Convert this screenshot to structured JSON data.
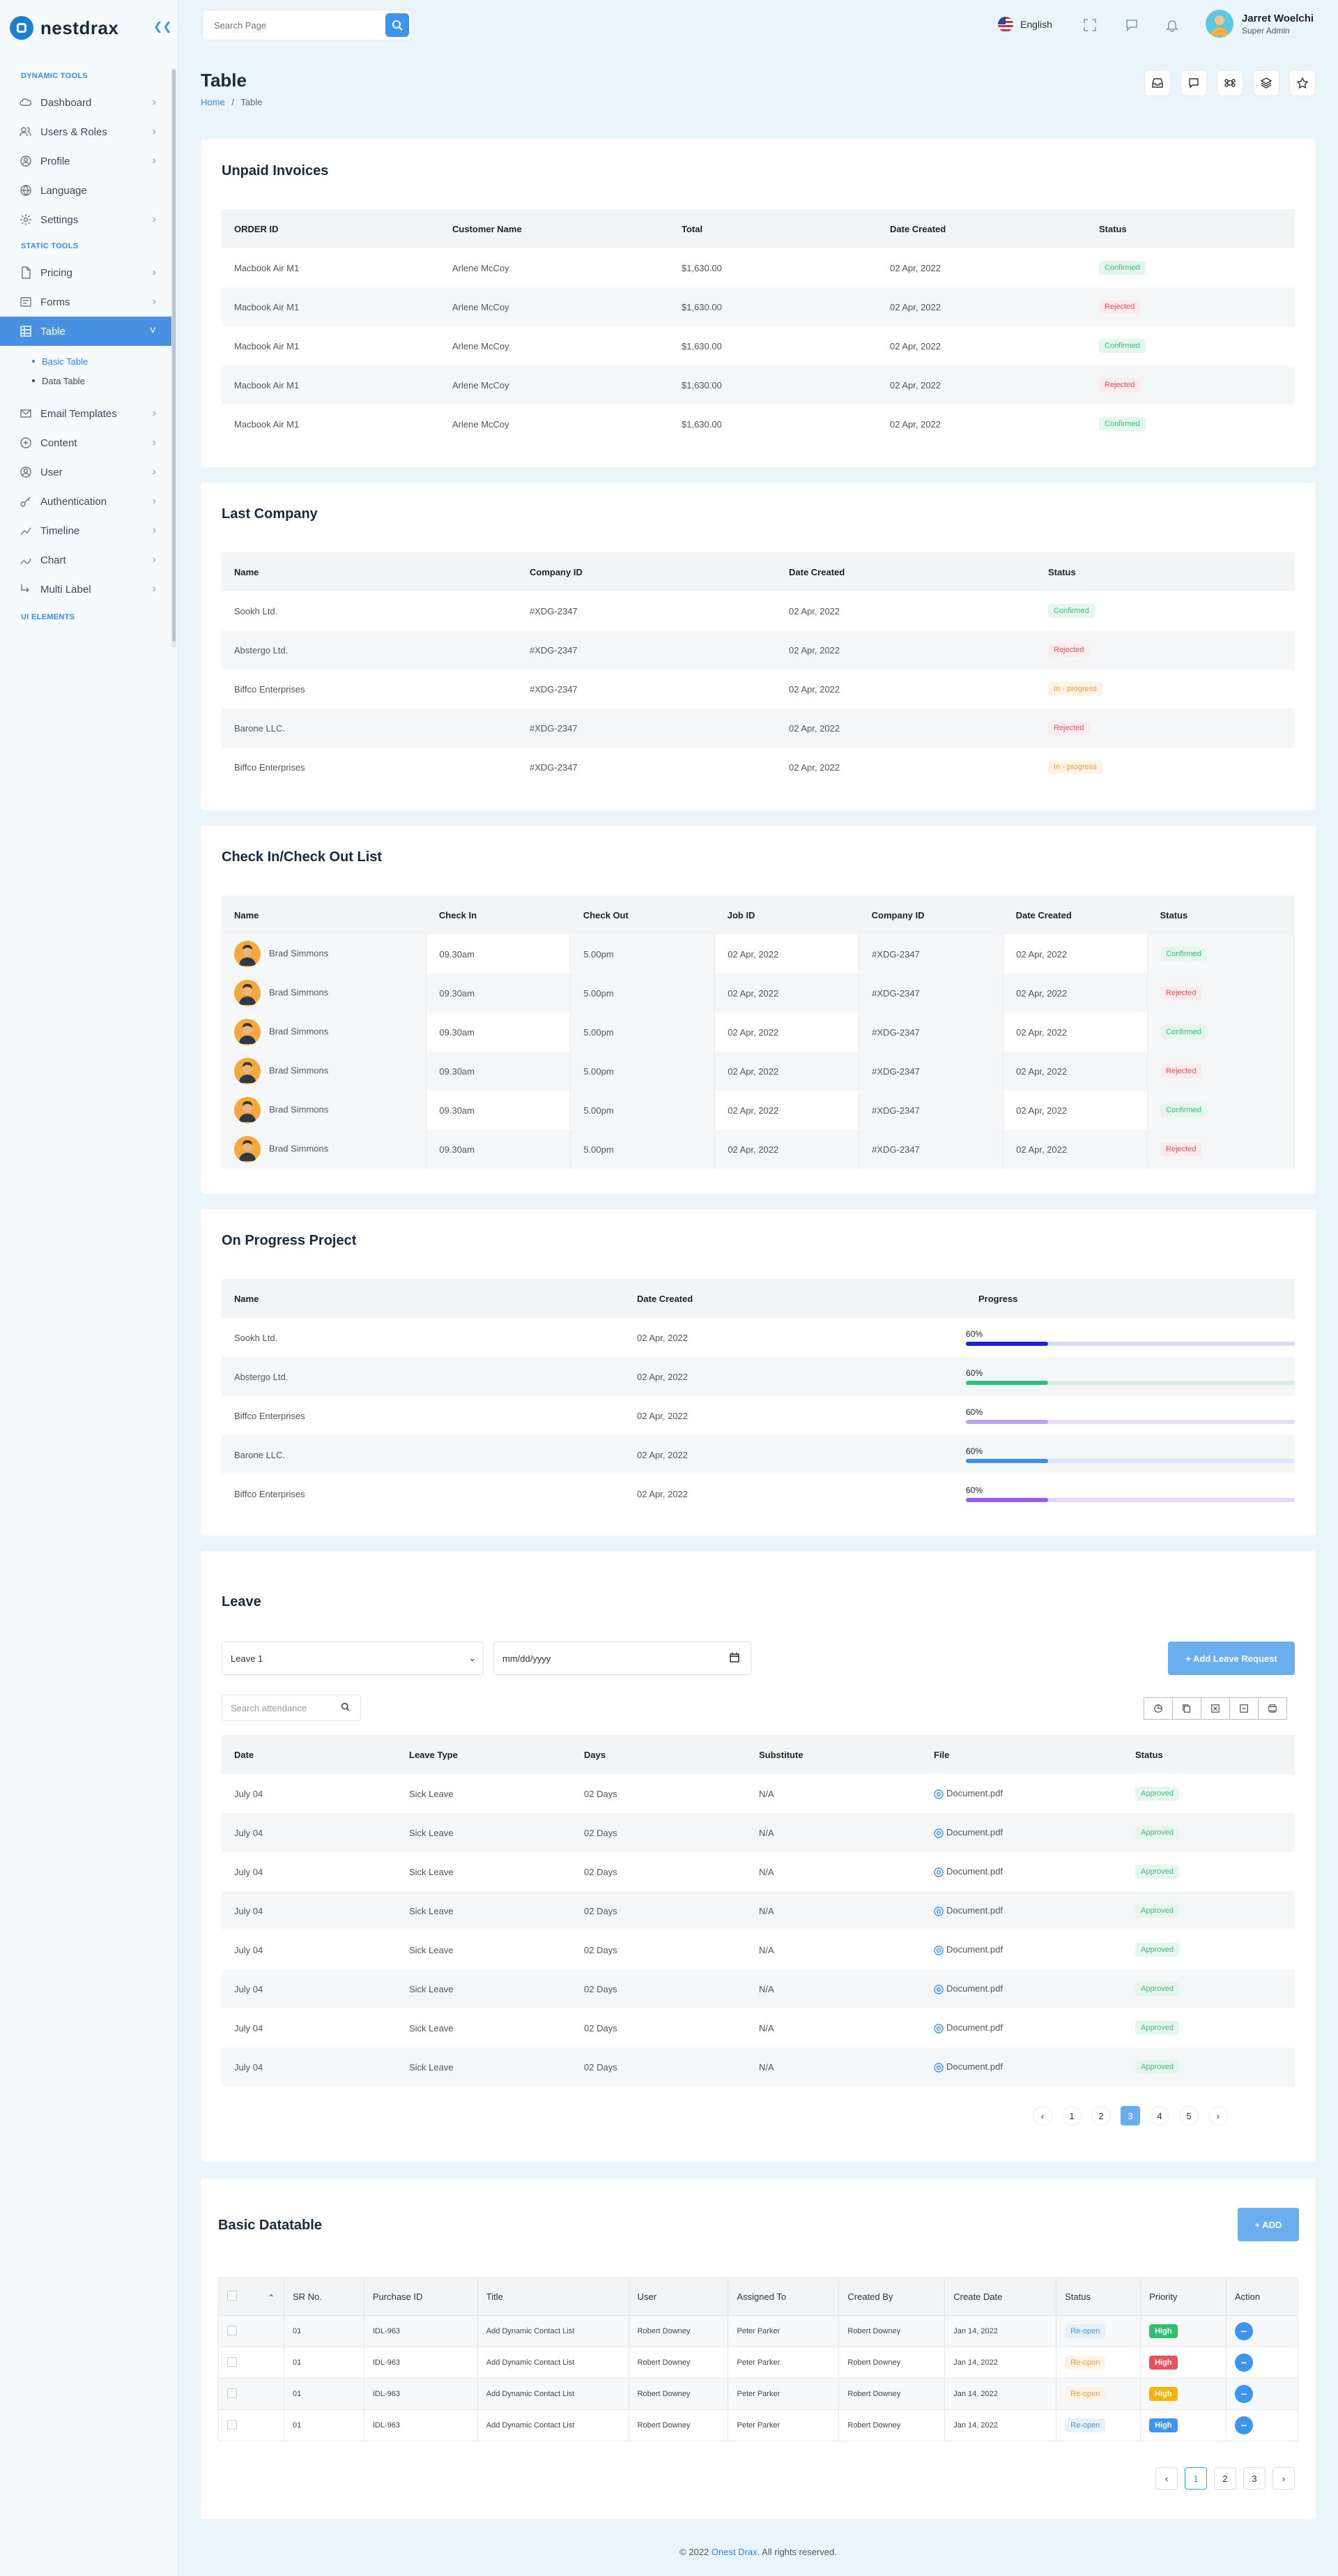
{
  "brand": {
    "name": "nestdrax"
  },
  "search": {
    "placeholder": "Search Page"
  },
  "topbar": {
    "language": "English",
    "user_name": "Jarret Woelchi",
    "user_role": "Super Admin"
  },
  "sidebar": {
    "section_dynamic": "DYNAMIC TOOLS",
    "section_static": "STATIC TOOLS",
    "section_ui": "UI ELEMENTS",
    "dynamic_items": [
      {
        "label": "Dashboard",
        "icon": "cloud-icon"
      },
      {
        "label": "Users & Roles",
        "icon": "users-icon"
      },
      {
        "label": "Profile",
        "icon": "profile-icon"
      },
      {
        "label": "Language",
        "icon": "globe-icon"
      },
      {
        "label": "Settings",
        "icon": "gear-icon"
      }
    ],
    "static_items": [
      {
        "label": "Pricing",
        "icon": "document-icon"
      },
      {
        "label": "Forms",
        "icon": "forms-icon"
      },
      {
        "label": "Table",
        "icon": "table-icon"
      },
      {
        "label": "Email Templates",
        "icon": "email-icon"
      },
      {
        "label": "Content",
        "icon": "content-icon"
      },
      {
        "label": "User",
        "icon": "user-icon"
      },
      {
        "label": "Authentication",
        "icon": "key-icon"
      },
      {
        "label": "Timeline",
        "icon": "timeline-icon"
      },
      {
        "label": "Chart",
        "icon": "chart-icon"
      },
      {
        "label": "Multi Label",
        "icon": "multi-label-icon"
      }
    ],
    "table_sub": [
      "Basic Table",
      "Data Table"
    ]
  },
  "page": {
    "title": "Table",
    "crumb_home": "Home",
    "crumb_sep": "/",
    "crumb_current": "Table"
  },
  "invoices": {
    "title": "Unpaid Invoices",
    "headers": [
      "ORDER ID",
      "Customer Name",
      "Total",
      "Date Created",
      "Status"
    ],
    "rows": [
      [
        "Macbook Air M1",
        "Arlene McCoy",
        "$1,630.00",
        "02 Apr, 2022",
        "Confirmed"
      ],
      [
        "Macbook Air M1",
        "Arlene McCoy",
        "$1,630.00",
        "02 Apr, 2022",
        "Rejected"
      ],
      [
        "Macbook Air M1",
        "Arlene McCoy",
        "$1,630.00",
        "02 Apr, 2022",
        "Confirmed"
      ],
      [
        "Macbook Air M1",
        "Arlene McCoy",
        "$1,630.00",
        "02 Apr, 2022",
        "Rejected"
      ],
      [
        "Macbook Air M1",
        "Arlene McCoy",
        "$1,630.00",
        "02 Apr, 2022",
        "Confirmed"
      ]
    ]
  },
  "company": {
    "title": "Last Company",
    "headers": [
      "Name",
      "Company ID",
      "Date Created",
      "Status"
    ],
    "rows": [
      [
        "Sookh Ltd.",
        "#XDG-2347",
        "02 Apr, 2022",
        "Confirmed"
      ],
      [
        "Abstergo Ltd.",
        "#XDG-2347",
        "02 Apr, 2022",
        "Rejected"
      ],
      [
        "Biffco Enterprises",
        "#XDG-2347",
        "02 Apr, 2022",
        "In - progress"
      ],
      [
        "Barone LLC.",
        "#XDG-2347",
        "02 Apr, 2022",
        "Rejected"
      ],
      [
        "Biffco Enterprises",
        "#XDG-2347",
        "02 Apr, 2022",
        "In - progress"
      ]
    ]
  },
  "checkin": {
    "title": "Check In/Check Out List",
    "headers": [
      "Name",
      "Check In",
      "Check Out",
      "Job ID",
      "Company ID",
      "Date Created",
      "Status"
    ],
    "rows": [
      [
        "Brad Simmons",
        "09.30am",
        "5.00pm",
        "02 Apr, 2022",
        "#XDG-2347",
        "02 Apr, 2022",
        "Confirmed"
      ],
      [
        "Brad Simmons",
        "09.30am",
        "5.00pm",
        "02 Apr, 2022",
        "#XDG-2347",
        "02 Apr, 2022",
        "Rejected"
      ],
      [
        "Brad Simmons",
        "09.30am",
        "5.00pm",
        "02 Apr, 2022",
        "#XDG-2347",
        "02 Apr, 2022",
        "Confirmed"
      ],
      [
        "Brad Simmons",
        "09.30am",
        "5.00pm",
        "02 Apr, 2022",
        "#XDG-2347",
        "02 Apr, 2022",
        "Rejected"
      ],
      [
        "Brad Simmons",
        "09.30am",
        "5.00pm",
        "02 Apr, 2022",
        "#XDG-2347",
        "02 Apr, 2022",
        "Confirmed"
      ],
      [
        "Brad Simmons",
        "09.30am",
        "5.00pm",
        "02 Apr, 2022",
        "#XDG-2347",
        "02 Apr, 2022",
        "Rejected"
      ]
    ]
  },
  "progress": {
    "title": "On Progress Project",
    "headers": [
      "Name",
      "Date Created",
      "Progress"
    ],
    "rows": [
      {
        "name": "Sookh Ltd.",
        "date": "02 Apr, 2022",
        "label": "60%",
        "value": 0.6,
        "color": "#1f1fd6",
        "track": "#d9dcf7"
      },
      {
        "name": "Abstergo Ltd.",
        "date": "02 Apr, 2022",
        "label": "60%",
        "value": 0.6,
        "color": "#2ec27e",
        "track": "#d5f0e3"
      },
      {
        "name": "Biffco Enterprises",
        "date": "02 Apr, 2022",
        "label": "60%",
        "value": 0.6,
        "color": "#b9a2f0",
        "track": "#e6dcfa"
      },
      {
        "name": "Barone LLC.",
        "date": "02 Apr, 2022",
        "label": "60%",
        "value": 0.6,
        "color": "#3e8fe8",
        "track": "#d5e5fa"
      },
      {
        "name": "Biffco Enterprises",
        "date": "02 Apr, 2022",
        "label": "60%",
        "value": 0.6,
        "color": "#9a5be8",
        "track": "#e6d8fa"
      }
    ]
  },
  "leave": {
    "title": "Leave",
    "select_value": "Leave 1",
    "date_placeholder": "mm/dd/yyyy",
    "add_button": "+ Add Leave Request",
    "search_placeholder": "Search attendance",
    "export_icons": [
      "pie-icon",
      "copy-icon",
      "excel-icon",
      "csv-icon",
      "print-icon"
    ],
    "headers": [
      "Date",
      "Leave Type",
      "Days",
      "Substitute",
      "File",
      "Status"
    ],
    "rows": [
      [
        "July 04",
        "Sick Leave",
        "02 Days",
        "N/A",
        "Document.pdf",
        "Approved"
      ],
      [
        "July 04",
        "Sick Leave",
        "02 Days",
        "N/A",
        "Document.pdf",
        "Approved"
      ],
      [
        "July 04",
        "Sick Leave",
        "02 Days",
        "N/A",
        "Document.pdf",
        "Approved"
      ],
      [
        "July 04",
        "Sick Leave",
        "02 Days",
        "N/A",
        "Document.pdf",
        "Approved"
      ],
      [
        "July 04",
        "Sick Leave",
        "02 Days",
        "N/A",
        "Document.pdf",
        "Approved"
      ],
      [
        "July 04",
        "Sick Leave",
        "02 Days",
        "N/A",
        "Document.pdf",
        "Approved"
      ],
      [
        "July 04",
        "Sick Leave",
        "02 Days",
        "N/A",
        "Document.pdf",
        "Approved"
      ],
      [
        "July 04",
        "Sick Leave",
        "02 Days",
        "N/A",
        "Document.pdf",
        "Approved"
      ]
    ],
    "pages": [
      "1",
      "2",
      "3",
      "4",
      "5"
    ],
    "current_page": "3"
  },
  "datatable": {
    "title": "Basic Datatable",
    "add_button": "+ ADD",
    "headers": [
      "SR No.",
      "Purchase ID",
      "Title",
      "User",
      "Assigned To",
      "Created By",
      "Create Date",
      "Status",
      "Priority",
      "Action"
    ],
    "rows": [
      {
        "sr": "01",
        "pid": "IDL-963",
        "title": "Add Dynamic Contact List",
        "user": "Robert Downey",
        "assigned": "Peter Parker",
        "created": "Robert Downey",
        "date": "Jan 14, 2022",
        "status": "Re-open",
        "status_style": "blue",
        "priority": "High",
        "priority_color": "#2fbf71"
      },
      {
        "sr": "01",
        "pid": "IDL-963",
        "title": "Add Dynamic Contact List",
        "user": "Robert Downey",
        "assigned": "Peter Parker",
        "created": "Robert Downey",
        "date": "Jan 14, 2022",
        "status": "Re-open",
        "status_style": "orange",
        "priority": "High",
        "priority_color": "#ec4f5d"
      },
      {
        "sr": "01",
        "pid": "IDL-963",
        "title": "Add Dynamic Contact List",
        "user": "Robert Downey",
        "assigned": "Peter Parker",
        "created": "Robert Downey",
        "date": "Jan 14, 2022",
        "status": "Re-open",
        "status_style": "orange",
        "priority": "High",
        "priority_color": "#f4b400"
      },
      {
        "sr": "01",
        "pid": "IDL-963",
        "title": "Add Dynamic Contact List",
        "user": "Robert Downey",
        "assigned": "Peter Parker",
        "created": "Robert Downey",
        "date": "Jan 14, 2022",
        "status": "Re-open",
        "status_style": "blue",
        "priority": "High",
        "priority_color": "#3e95ee"
      }
    ],
    "pages": [
      "1",
      "2",
      "3"
    ],
    "current_page": "1"
  },
  "footer": {
    "prefix": "© 2022",
    "brand": "Onest Drax",
    "suffix": ". All rights reserved."
  }
}
